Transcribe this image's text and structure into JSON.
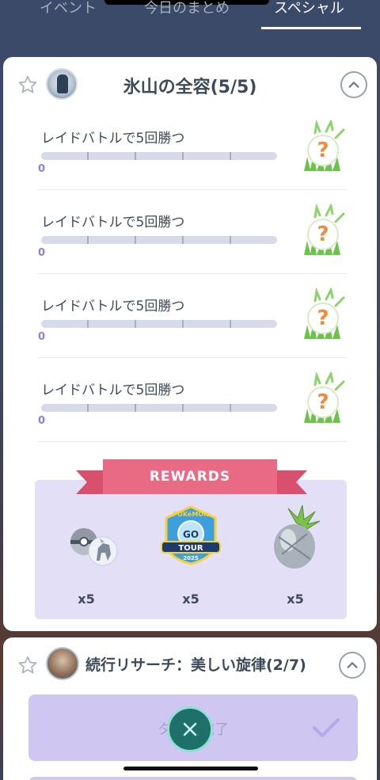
{
  "tabs": [
    {
      "label": "イベント"
    },
    {
      "label": "今日のまとめ"
    },
    {
      "label": "スペシャル"
    }
  ],
  "active_tab": "スペシャル",
  "research1": {
    "title": "氷山の全容(5/5)",
    "tasks": [
      {
        "label": "レイドバトルで5回勝つ",
        "progress": 0,
        "count_text": "0",
        "total": 5
      },
      {
        "label": "レイドバトルで5回勝つ",
        "progress": 0,
        "count_text": "0",
        "total": 5
      },
      {
        "label": "レイドバトルで5回勝つ",
        "progress": 0,
        "count_text": "0",
        "total": 5
      },
      {
        "label": "レイドバトルで5回勝つ",
        "progress": 0,
        "count_text": "0",
        "total": 5
      }
    ],
    "task_reward_icon": "mystery-reward-icon",
    "task_reward_glyph": "?",
    "rewards_title": "REWARDS",
    "rewards": [
      {
        "icon": "pokemon-encounter-icon",
        "count": "x5"
      },
      {
        "icon": "go-tour-2025-badge-icon",
        "count": "x5"
      },
      {
        "icon": "silver-pinap-berry-icon",
        "count": "x5"
      }
    ]
  },
  "research2": {
    "title": "続行リサーチ：美しい旋律(2/7)",
    "done_label": "タスク完了"
  },
  "tour_badge": {
    "top": "POKéMON",
    "mid": "GO",
    "band": "TOUR",
    "year": "2025"
  },
  "colors": {
    "accent_purple": "#8e7fd7",
    "ribbon": "#e96a85",
    "rewards_bg": "#e2dff7",
    "quest_orange": "#f08a3c"
  }
}
